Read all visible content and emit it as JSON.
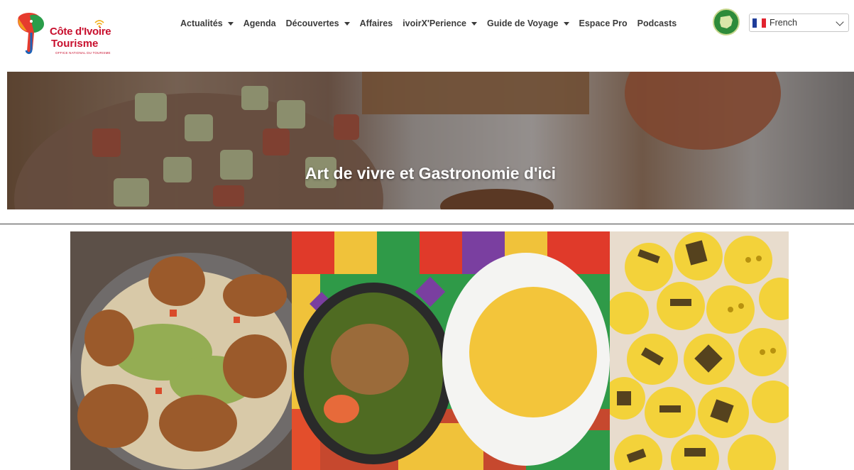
{
  "brand": {
    "line1": "Côte d'Ivoire",
    "line2": "Tourisme",
    "line3": "OFFICE NATIONAL DU TOURISME",
    "accent_color": "#c8102e"
  },
  "nav": {
    "items": [
      {
        "label": "Actualités",
        "has_dropdown": true
      },
      {
        "label": "Agenda",
        "has_dropdown": false
      },
      {
        "label": "Découvertes",
        "has_dropdown": true
      },
      {
        "label": "Affaires",
        "has_dropdown": false
      },
      {
        "label": "ivoirX'Perience",
        "has_dropdown": true
      },
      {
        "label": "Guide de Voyage",
        "has_dropdown": true
      },
      {
        "label": "Espace Pro",
        "has_dropdown": false
      },
      {
        "label": "Podcasts",
        "has_dropdown": false
      }
    ],
    "caret_icon": "caret-down-icon"
  },
  "language": {
    "selected": "French",
    "flag_icon": "france-flag-icon",
    "chevron_icon": "chevron-down-icon"
  },
  "hero": {
    "title": "Art de vivre et Gastronomie d'ici"
  },
  "gallery": {
    "photos": [
      {
        "name": "attieke-poisson-photo"
      },
      {
        "name": "sauce-foutou-photo"
      },
      {
        "name": "grilled-corn-cakes-photo"
      }
    ]
  }
}
